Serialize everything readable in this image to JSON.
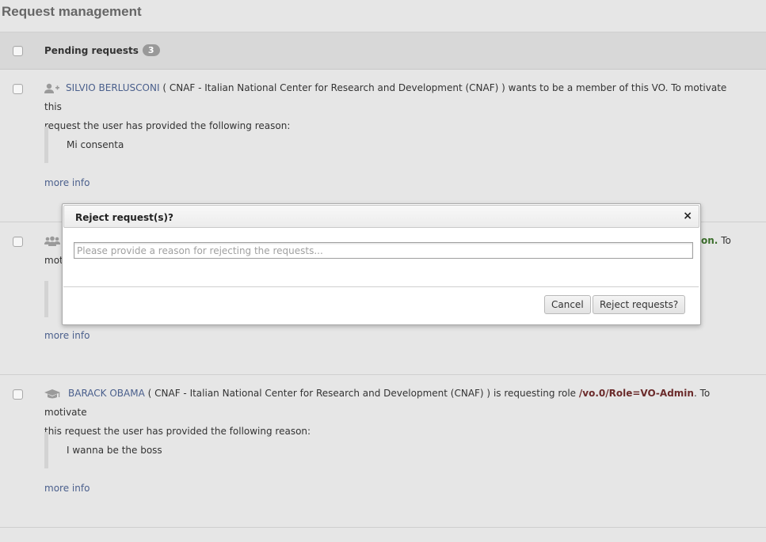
{
  "page": {
    "title": "Request management"
  },
  "list": {
    "header": "Pending requests",
    "count": "3",
    "more_info": "more info"
  },
  "requests": [
    {
      "user": "SILVIO BERLUSCONI",
      "institution": "( CNAF - Italian National Center for Research and Development (CNAF) )",
      "action": "wants to be a member of this VO. To motivate this",
      "continuation": "request the user has provided the following reason:",
      "reason": "Mi consenta",
      "icon": "user-add-icon"
    },
    {
      "visible_right": "on.",
      "visible_right_after": "To",
      "visible_left": "mot",
      "icon": "group-icon"
    },
    {
      "user": "BARACK OBAMA",
      "institution": "( CNAF - Italian National Center for Research and Development (CNAF) )",
      "action": "is requesting role",
      "role": "/vo.0/Role=VO-Admin",
      "action_after": ". To motivate",
      "continuation": "this request the user has provided the following reason:",
      "reason": "I wanna be the boss",
      "icon": "graduation-cap-icon"
    }
  ],
  "modal": {
    "title": "Reject request(s)?",
    "close": "×",
    "input_placeholder": "Please provide a reason for rejecting the requests...",
    "cancel": "Cancel",
    "confirm": "Reject requests?"
  },
  "colors": {
    "link": "#4a5f8c",
    "role": "#6b2b2b",
    "badge": "#999999"
  }
}
